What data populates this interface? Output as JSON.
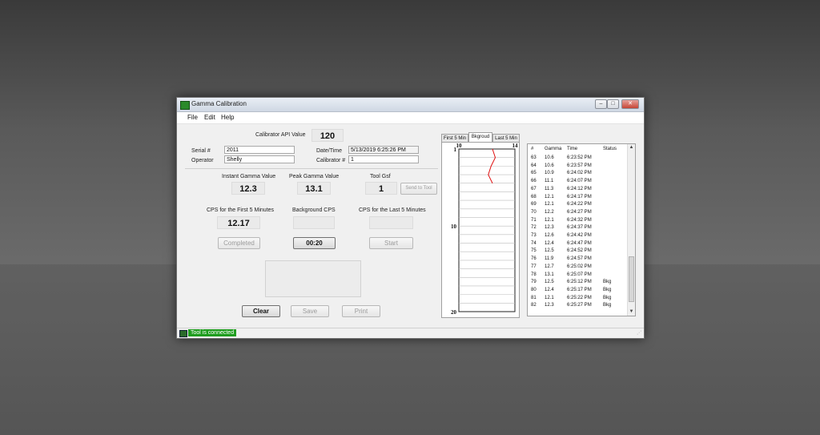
{
  "window": {
    "title": "Gamma Calibration"
  },
  "menu": {
    "file": "File",
    "edit": "Edit",
    "help": "Help"
  },
  "calibrator": {
    "api_label": "Calibrator API Value",
    "api_value": "120"
  },
  "form": {
    "serial_label": "Serial #",
    "serial_value": "2011",
    "operator_label": "Operator",
    "operator_value": "Shelly",
    "datetime_label": "Date/Time",
    "datetime_value": "5/13/2019 6:25:26 PM",
    "calibrator_num_label": "Calibrator #",
    "calibrator_num_value": "1"
  },
  "readouts": {
    "instant_label": "Instant Gamma Value",
    "instant_value": "12.3",
    "peak_label": "Peak Gamma Value",
    "peak_value": "13.1",
    "tool_gsf_label": "Tool Gsf",
    "tool_gsf_value": "1",
    "send_to_tool": "Send to Tool",
    "cps_first_label": "CPS for the First 5 Minutes",
    "cps_first_value": "12.17",
    "bg_cps_label": "Background CPS",
    "bg_cps_value": "",
    "cps_last_label": "CPS for the Last 5 Minutes",
    "cps_last_value": ""
  },
  "buttons": {
    "completed": "Completed",
    "timer": "00:20",
    "start": "Start",
    "clear": "Clear",
    "save": "Save",
    "print": "Print"
  },
  "tabs": [
    "First 5 Min",
    "Bkgroud",
    "Last 5 Min"
  ],
  "chart_data": {
    "type": "line",
    "x_ticks": [
      "10",
      "14"
    ],
    "y_ticks": [
      "1",
      "10",
      "20"
    ],
    "xlim": [
      10,
      14
    ],
    "ylim": [
      1,
      20
    ],
    "series": [
      {
        "color": "#e01010",
        "x": [
          12.4,
          12.6,
          12.3,
          12.1,
          12.4
        ],
        "y": [
          1,
          2,
          3,
          4,
          5
        ]
      }
    ]
  },
  "table": {
    "headers": [
      "#",
      "Gamma",
      "Time",
      "Status"
    ],
    "rows": [
      [
        "63",
        "10.6",
        "6:23:52 PM",
        ""
      ],
      [
        "64",
        "10.6",
        "6:23:57 PM",
        ""
      ],
      [
        "65",
        "10.9",
        "6:24:02 PM",
        ""
      ],
      [
        "66",
        "11.1",
        "6:24:07 PM",
        ""
      ],
      [
        "67",
        "11.3",
        "6:24:12 PM",
        ""
      ],
      [
        "68",
        "12.1",
        "6:24:17 PM",
        ""
      ],
      [
        "69",
        "12.1",
        "6:24:22 PM",
        ""
      ],
      [
        "70",
        "12.2",
        "6:24:27 PM",
        ""
      ],
      [
        "71",
        "12.1",
        "6:24:32 PM",
        ""
      ],
      [
        "72",
        "12.3",
        "6:24:37 PM",
        ""
      ],
      [
        "73",
        "12.6",
        "6:24:42 PM",
        ""
      ],
      [
        "74",
        "12.4",
        "6:24:47 PM",
        ""
      ],
      [
        "75",
        "12.5",
        "6:24:52 PM",
        ""
      ],
      [
        "76",
        "11.9",
        "6:24:57 PM",
        ""
      ],
      [
        "77",
        "12.7",
        "6:25:02 PM",
        ""
      ],
      [
        "78",
        "13.1",
        "6:25:07 PM",
        ""
      ],
      [
        "79",
        "12.5",
        "6:25:12 PM",
        "Bkg"
      ],
      [
        "80",
        "12.4",
        "6:25:17 PM",
        "Bkg"
      ],
      [
        "81",
        "12.1",
        "6:25:22 PM",
        "Bkg"
      ],
      [
        "82",
        "12.3",
        "6:25:27 PM",
        "Bkg"
      ]
    ]
  },
  "status": {
    "text": "Tool is connected"
  }
}
